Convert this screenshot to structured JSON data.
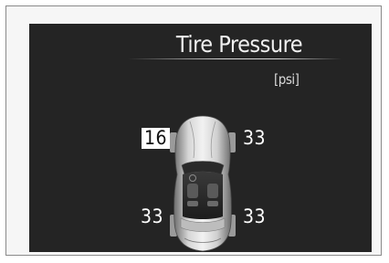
{
  "screen": {
    "title": "Tire Pressure",
    "unit": "[psi]"
  },
  "tires": {
    "front_left": "16",
    "front_right": "33",
    "rear_left": "33",
    "rear_right": "33"
  },
  "colors": {
    "background": "#242424",
    "text": "#ffffff",
    "alert_highlight": "#ffffff"
  }
}
